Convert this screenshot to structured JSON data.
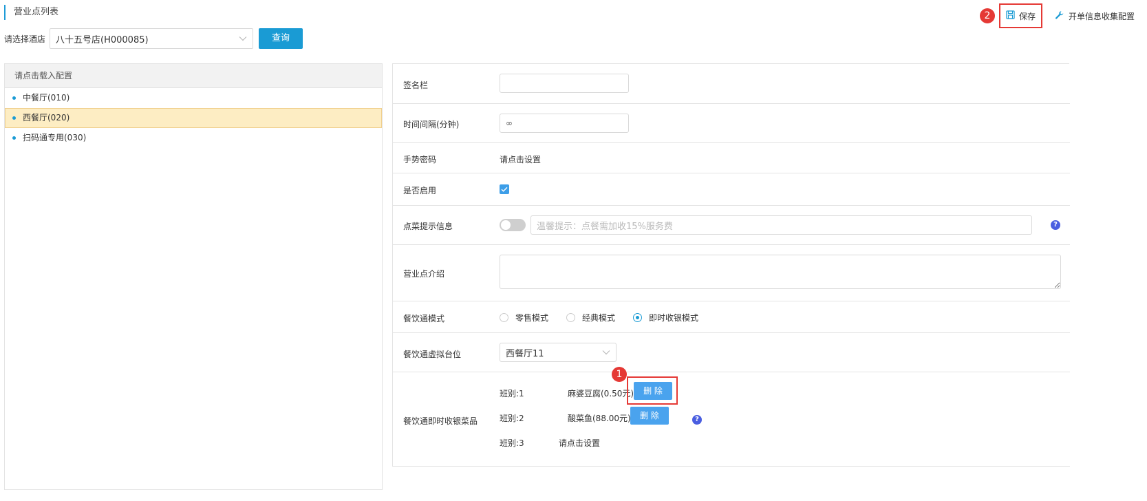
{
  "header": {
    "title": "营业点列表",
    "save_badge": "2",
    "save_label": "保存",
    "config_label": "开单信息收集配置"
  },
  "hotel": {
    "label": "请选择酒店",
    "selected": "八十五号店(H000085)",
    "query_label": "查询"
  },
  "left": {
    "header": "请点击载入配置",
    "items": [
      {
        "label": "中餐厅(010)"
      },
      {
        "label": "西餐厅(020)"
      },
      {
        "label": "扫码通专用(030)"
      }
    ]
  },
  "form": {
    "signature": {
      "label": "签名栏",
      "value": ""
    },
    "interval": {
      "label": "时间间隔(分钟)",
      "value": "∞"
    },
    "gesture": {
      "label": "手势密码",
      "value": "请点击设置"
    },
    "enabled": {
      "label": "是否启用"
    },
    "tip": {
      "label": "点菜提示信息",
      "placeholder": "温馨提示：点餐需加收15%服务费"
    },
    "intro": {
      "label": "营业点介绍"
    },
    "mode": {
      "label": "餐饮通模式",
      "options": [
        "零售模式",
        "经典模式",
        "即时收银模式"
      ],
      "selected": "即时收银模式"
    },
    "table": {
      "label": "餐饮通虚拟台位",
      "selected": "西餐厅11"
    },
    "dishes": {
      "label": "餐饮通即时收银菜品",
      "badge": "1",
      "delete_label": "删 除",
      "items": [
        {
          "shift": "班别:1",
          "dish": "麻婆豆腐(0.50元)"
        },
        {
          "shift": "班别:2",
          "dish": "酸菜鱼(88.00元)"
        },
        {
          "shift": "班别:3",
          "dish": "请点击设置"
        }
      ]
    }
  },
  "colors": {
    "accent": "#1a9bd4",
    "highlight": "#fdedc3",
    "badge": "#e53935"
  },
  "icons": {
    "save": "save-icon",
    "config": "wrench-icon",
    "help": "help-icon",
    "select": "chevron-down-icon"
  }
}
